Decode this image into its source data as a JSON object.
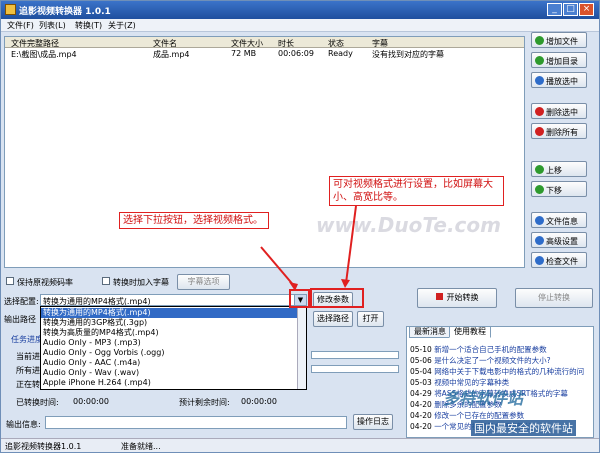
{
  "window": {
    "title": "追影视频转换器 1.0.1"
  },
  "menu": [
    "文件(F)",
    "列表(L)",
    "转换(T)",
    "关于(Z)"
  ],
  "table": {
    "columns": [
      "文件完整路径",
      "文件名",
      "文件大小",
      "时长",
      "状态",
      "字幕"
    ],
    "rows": [
      [
        "E:\\截图\\成品.mp4",
        "成品.mp4",
        "72 MB",
        "00:06:09",
        "Ready",
        "没有找到对应的字幕"
      ]
    ]
  },
  "watermark": "www.DuoTe.com",
  "side_buttons": [
    {
      "label": "增加文件",
      "icon": "add-file-icon",
      "color": "#2e9a2e"
    },
    {
      "label": "增加目录",
      "icon": "add-folder-icon",
      "color": "#2e9a2e"
    },
    {
      "label": "播放选中",
      "icon": "play-icon",
      "color": "#2e6cc9"
    },
    {
      "label": "删除选中",
      "icon": "delete-icon",
      "color": "#d02020"
    },
    {
      "label": "删除所有",
      "icon": "delete-all-icon",
      "color": "#d02020"
    },
    {
      "label": "上移",
      "icon": "up-icon",
      "color": "#2e9a2e"
    },
    {
      "label": "下移",
      "icon": "down-icon",
      "color": "#2e9a2e"
    },
    {
      "label": "文件信息",
      "icon": "info-icon",
      "color": "#2e6cc9"
    },
    {
      "label": "高级设置",
      "icon": "settings-icon",
      "color": "#2e6cc9"
    },
    {
      "label": "检查文件",
      "icon": "check-icon",
      "color": "#2e6cc9"
    }
  ],
  "options": {
    "keep_rate": "保持原视频码率",
    "add_subtitle": "转换时加入字幕",
    "subtitle_btn": "字幕选项"
  },
  "config": {
    "label": "选择配置:",
    "selected": "转换为通用的MP4格式(.mp4)",
    "edit_btn": "修改参数"
  },
  "dropdown": [
    "转换为通用的MP4格式(.mp4)",
    "转换为通用的3GP格式(.3gp)",
    "转换为高质量的MP4格式(.mp4)",
    "Audio Only - MP3 (.mp3)",
    "Audio Only - Ogg Vorbis (.ogg)",
    "Audio Only - AAC (.m4a)",
    "Audio Only - Wav (.wav)",
    "Apple iPhone H.264 (.mp4)"
  ],
  "output": {
    "path_label": "输出路径",
    "choose_btn": "选择路径",
    "open_btn": "打开"
  },
  "progress": {
    "task": "任务进度",
    "current": "当前进",
    "all": "所有进",
    "converting": "正在转",
    "elapsed_label": "已转换时间:",
    "elapsed": "00:00:00",
    "remaining_label": "预计剩余时间:",
    "remaining": "00:00:00"
  },
  "info": {
    "label": "输出信息:",
    "log_btn": "操作日志"
  },
  "actions": {
    "start": "开始转换",
    "stop": "停止转换"
  },
  "callouts": {
    "left": "选择下拉按钮，选择视频格式。",
    "right": "可对视频格式进行设置，比如屏幕大小、高宽比等。"
  },
  "tabs": [
    "最新消息",
    "使用教程"
  ],
  "news": [
    [
      "05-10",
      "新增一个适合自己手机的配置参数"
    ],
    [
      "05-06",
      "是什么决定了一个视频文件的大小?"
    ],
    [
      "05-04",
      "网络中关于下载电影中的格式的几种流行的问"
    ],
    [
      "05-03",
      "视频中常见的字幕种类"
    ],
    [
      "04-29",
      "将ASS格式的字幕转换成SRT格式的字幕"
    ],
    [
      "04-20",
      "删除多余的配置参数"
    ],
    [
      "04-20",
      "修改一个已存在的配置参数"
    ],
    [
      "04-20",
      "一个常见的视频包含哪些部分"
    ]
  ],
  "status": {
    "app": "追影视频转换器1.0.1",
    "state": "准备就绪..."
  },
  "brand": {
    "logo": "多特软件站",
    "footer": "国内最安全的软件站"
  }
}
